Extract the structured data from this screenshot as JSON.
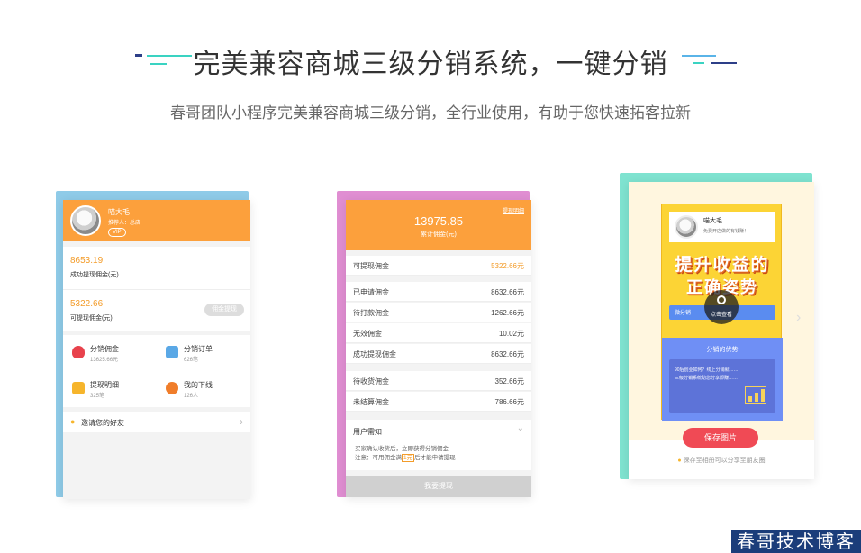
{
  "header": {
    "title": "完美兼容商城三级分销系统，一键分销",
    "subtitle": "春哥团队小程序完美兼容商城三级分销，全行业使用，有助于您快速拓客拉新",
    "accent_colors": [
      "#3ad3c2",
      "#2d3f88",
      "#5ab4e8"
    ]
  },
  "card1": {
    "user_name": "喵大毛",
    "referrer": "推荐人：总店",
    "vip_badge": "VIP",
    "success_amount": "8653.19",
    "success_label": "成功提现佣金(元)",
    "available_amount": "5322.66",
    "available_label": "可提现佣金(元)",
    "withdraw_button": "佣金提现",
    "grid": [
      {
        "title": "分销佣金",
        "sub": "13625.66元",
        "icon": "money-bag-icon"
      },
      {
        "title": "分销订单",
        "sub": "626笔",
        "icon": "order-clipboard-icon"
      },
      {
        "title": "提现明细",
        "sub": "325笔",
        "icon": "wallet-icon"
      },
      {
        "title": "我的下线",
        "sub": "126人",
        "icon": "people-icon"
      }
    ],
    "invite_label": "邀请您的好友",
    "invite_icon": "bulb-icon"
  },
  "card2": {
    "total_amount": "13975.85",
    "total_label": "累计佣金(元)",
    "detail_link": "提现明细",
    "rows_a": [
      {
        "label": "可提现佣金",
        "value": "5322.66元",
        "highlight": true
      }
    ],
    "rows_b": [
      {
        "label": "已申请佣金",
        "value": "8632.66元"
      },
      {
        "label": "待打款佣金",
        "value": "1262.66元"
      },
      {
        "label": "无效佣金",
        "value": "10.02元"
      },
      {
        "label": "成功提现佣金",
        "value": "8632.66元"
      }
    ],
    "rows_c": [
      {
        "label": "待收货佣金",
        "value": "352.66元"
      },
      {
        "label": "未结算佣金",
        "value": "786.66元"
      }
    ],
    "notice_title": "用户需知",
    "notice_line1": "买家确认收货后，立即获得分销佣金",
    "notice_line2_a": "注意：可用佣金满",
    "notice_line2_b": "1元",
    "notice_line2_c": "后才能申请提现",
    "withdraw_button": "我要提现"
  },
  "card3": {
    "poster_user": "喵大毛",
    "poster_user_sub": "免费开店做的有钱赚！",
    "poster_line1": "提升收益的",
    "poster_line2": "正确姿势",
    "poster_ribbon": "微分销",
    "zoom_label": "点击查看",
    "poster_adv": "分销的优势",
    "poster_text": "90后创业如何？线上分销就……三级分销系统助您分享即赚……",
    "save_button": "保存图片",
    "save_tip": "保存至相册可以分享至朋友圈"
  },
  "watermark": "春哥技术博客"
}
